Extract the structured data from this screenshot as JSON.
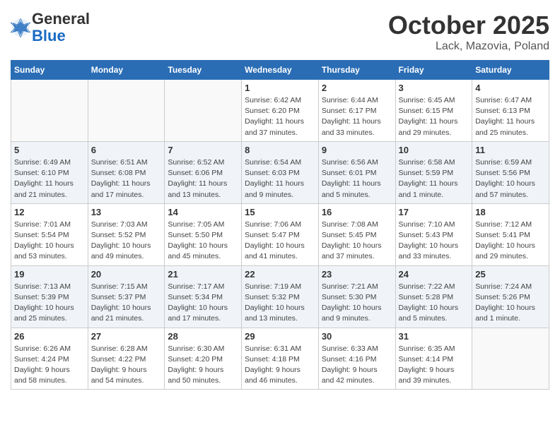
{
  "header": {
    "logo_general": "General",
    "logo_blue": "Blue",
    "month_title": "October 2025",
    "location": "Lack, Mazovia, Poland"
  },
  "weekdays": [
    "Sunday",
    "Monday",
    "Tuesday",
    "Wednesday",
    "Thursday",
    "Friday",
    "Saturday"
  ],
  "weeks": [
    [
      {
        "day": "",
        "info": ""
      },
      {
        "day": "",
        "info": ""
      },
      {
        "day": "",
        "info": ""
      },
      {
        "day": "1",
        "info": "Sunrise: 6:42 AM\nSunset: 6:20 PM\nDaylight: 11 hours\nand 37 minutes."
      },
      {
        "day": "2",
        "info": "Sunrise: 6:44 AM\nSunset: 6:17 PM\nDaylight: 11 hours\nand 33 minutes."
      },
      {
        "day": "3",
        "info": "Sunrise: 6:45 AM\nSunset: 6:15 PM\nDaylight: 11 hours\nand 29 minutes."
      },
      {
        "day": "4",
        "info": "Sunrise: 6:47 AM\nSunset: 6:13 PM\nDaylight: 11 hours\nand 25 minutes."
      }
    ],
    [
      {
        "day": "5",
        "info": "Sunrise: 6:49 AM\nSunset: 6:10 PM\nDaylight: 11 hours\nand 21 minutes."
      },
      {
        "day": "6",
        "info": "Sunrise: 6:51 AM\nSunset: 6:08 PM\nDaylight: 11 hours\nand 17 minutes."
      },
      {
        "day": "7",
        "info": "Sunrise: 6:52 AM\nSunset: 6:06 PM\nDaylight: 11 hours\nand 13 minutes."
      },
      {
        "day": "8",
        "info": "Sunrise: 6:54 AM\nSunset: 6:03 PM\nDaylight: 11 hours\nand 9 minutes."
      },
      {
        "day": "9",
        "info": "Sunrise: 6:56 AM\nSunset: 6:01 PM\nDaylight: 11 hours\nand 5 minutes."
      },
      {
        "day": "10",
        "info": "Sunrise: 6:58 AM\nSunset: 5:59 PM\nDaylight: 11 hours\nand 1 minute."
      },
      {
        "day": "11",
        "info": "Sunrise: 6:59 AM\nSunset: 5:56 PM\nDaylight: 10 hours\nand 57 minutes."
      }
    ],
    [
      {
        "day": "12",
        "info": "Sunrise: 7:01 AM\nSunset: 5:54 PM\nDaylight: 10 hours\nand 53 minutes."
      },
      {
        "day": "13",
        "info": "Sunrise: 7:03 AM\nSunset: 5:52 PM\nDaylight: 10 hours\nand 49 minutes."
      },
      {
        "day": "14",
        "info": "Sunrise: 7:05 AM\nSunset: 5:50 PM\nDaylight: 10 hours\nand 45 minutes."
      },
      {
        "day": "15",
        "info": "Sunrise: 7:06 AM\nSunset: 5:47 PM\nDaylight: 10 hours\nand 41 minutes."
      },
      {
        "day": "16",
        "info": "Sunrise: 7:08 AM\nSunset: 5:45 PM\nDaylight: 10 hours\nand 37 minutes."
      },
      {
        "day": "17",
        "info": "Sunrise: 7:10 AM\nSunset: 5:43 PM\nDaylight: 10 hours\nand 33 minutes."
      },
      {
        "day": "18",
        "info": "Sunrise: 7:12 AM\nSunset: 5:41 PM\nDaylight: 10 hours\nand 29 minutes."
      }
    ],
    [
      {
        "day": "19",
        "info": "Sunrise: 7:13 AM\nSunset: 5:39 PM\nDaylight: 10 hours\nand 25 minutes."
      },
      {
        "day": "20",
        "info": "Sunrise: 7:15 AM\nSunset: 5:37 PM\nDaylight: 10 hours\nand 21 minutes."
      },
      {
        "day": "21",
        "info": "Sunrise: 7:17 AM\nSunset: 5:34 PM\nDaylight: 10 hours\nand 17 minutes."
      },
      {
        "day": "22",
        "info": "Sunrise: 7:19 AM\nSunset: 5:32 PM\nDaylight: 10 hours\nand 13 minutes."
      },
      {
        "day": "23",
        "info": "Sunrise: 7:21 AM\nSunset: 5:30 PM\nDaylight: 10 hours\nand 9 minutes."
      },
      {
        "day": "24",
        "info": "Sunrise: 7:22 AM\nSunset: 5:28 PM\nDaylight: 10 hours\nand 5 minutes."
      },
      {
        "day": "25",
        "info": "Sunrise: 7:24 AM\nSunset: 5:26 PM\nDaylight: 10 hours\nand 1 minute."
      }
    ],
    [
      {
        "day": "26",
        "info": "Sunrise: 6:26 AM\nSunset: 4:24 PM\nDaylight: 9 hours\nand 58 minutes."
      },
      {
        "day": "27",
        "info": "Sunrise: 6:28 AM\nSunset: 4:22 PM\nDaylight: 9 hours\nand 54 minutes."
      },
      {
        "day": "28",
        "info": "Sunrise: 6:30 AM\nSunset: 4:20 PM\nDaylight: 9 hours\nand 50 minutes."
      },
      {
        "day": "29",
        "info": "Sunrise: 6:31 AM\nSunset: 4:18 PM\nDaylight: 9 hours\nand 46 minutes."
      },
      {
        "day": "30",
        "info": "Sunrise: 6:33 AM\nSunset: 4:16 PM\nDaylight: 9 hours\nand 42 minutes."
      },
      {
        "day": "31",
        "info": "Sunrise: 6:35 AM\nSunset: 4:14 PM\nDaylight: 9 hours\nand 39 minutes."
      },
      {
        "day": "",
        "info": ""
      }
    ]
  ]
}
